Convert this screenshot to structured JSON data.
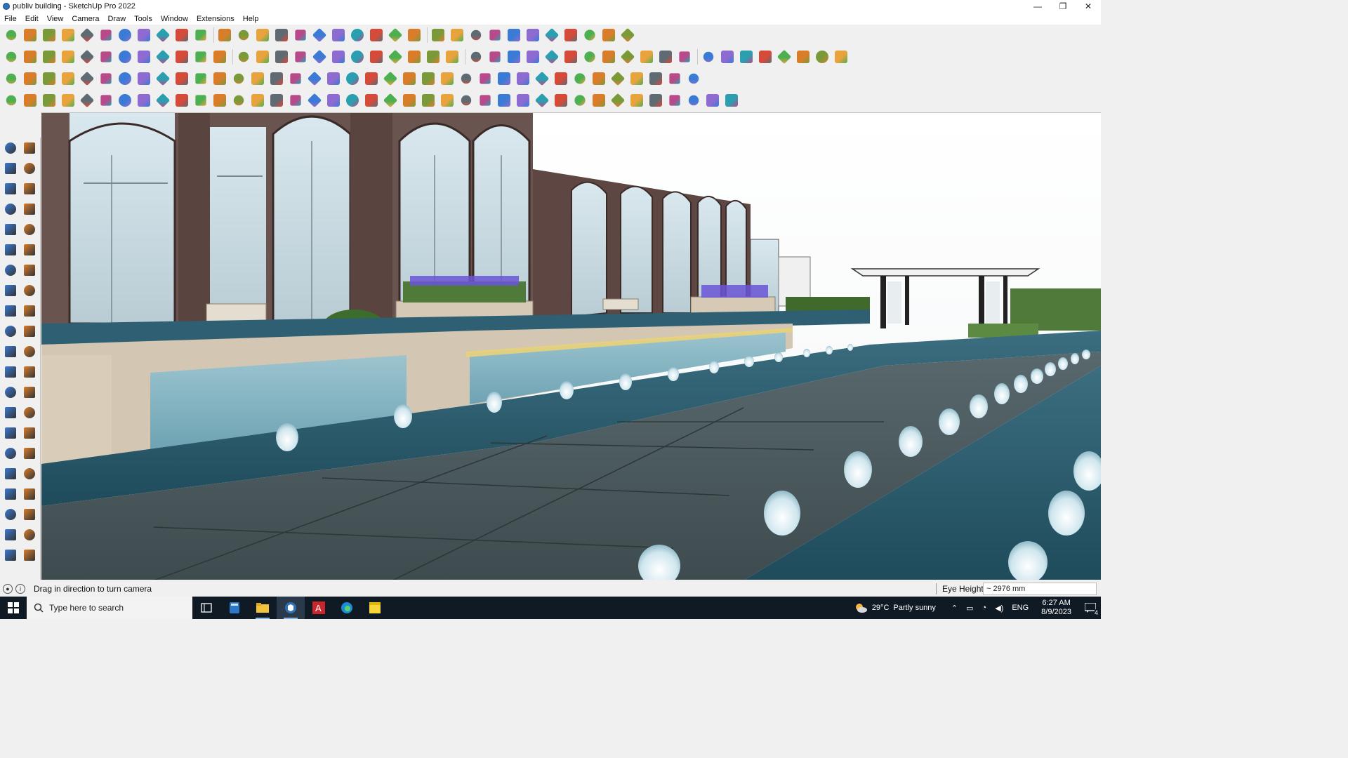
{
  "window": {
    "title": "publiv building - SketchUp Pro 2022",
    "controls": [
      "minimize-icon",
      "maximize-icon",
      "close-icon"
    ]
  },
  "menu": {
    "items": [
      "File",
      "Edit",
      "View",
      "Camera",
      "Draw",
      "Tools",
      "Window",
      "Extensions",
      "Help"
    ]
  },
  "toolbars": {
    "row1_icons": [
      "zoom-icon",
      "select-icon",
      "eraser-icon",
      "line-icon",
      "arc-icon",
      "rectangle-icon",
      "push-pull-icon",
      "follow-me-icon",
      "move-icon",
      "rotate-icon",
      "scale-icon",
      "tape-measure-icon",
      "text-icon",
      "paint-bucket-icon",
      "orbit-icon",
      "pan-icon",
      "zoom-window-icon",
      "zoom-extents-icon",
      "component-icon",
      "layers-icon",
      "layers-2-icon",
      "section-icon",
      "user-icon",
      "warehouse-icon",
      "extension-icon",
      "bar-icon",
      "updown-icon",
      "updown-2-icon",
      "match-photo-icon",
      "sandbox-icon",
      "undo-icon",
      "redo-icon",
      "trash-icon"
    ],
    "row2_icons": [
      "cube-icon",
      "cube-2-icon",
      "cube-3-icon",
      "axes-icon",
      "axes-x-icon",
      "axes-y-icon",
      "axes-r-icon",
      "axes-v-icon",
      "axes-n-icon",
      "axes-x2-icon",
      "axes-f-icon",
      "curve-icon",
      "blade-icon",
      "blade-2-icon",
      "blade-3-icon",
      "plane-icon",
      "plane-2-icon",
      "house-1-icon",
      "house-2-icon",
      "house-3-icon",
      "house-4-icon",
      "house-5-icon",
      "fx-icon",
      "leaf-icon",
      "knife-icon",
      "circle-1-icon",
      "circle-2-icon",
      "circle-3-icon",
      "circle-4-icon",
      "circle-5-icon",
      "circle-6-icon",
      "circle-7-icon",
      "circle-8-icon",
      "circle-9-icon",
      "circle-10-icon",
      "red-line-icon",
      "red-shape-icon",
      "cone-icon",
      "grid-icon",
      "sphere-icon",
      "sphere-2-icon",
      "hand-icon",
      "chip-icon",
      "chip-2-icon"
    ],
    "row3_icons": [
      "diamond-blue-icon",
      "diamond-blue-2-icon",
      "diamond-yellow-icon",
      "diamond-green-icon",
      "diamond-red-icon",
      "diamond-gray-icon",
      "spin-icon",
      "square-red-icon",
      "stack-icon",
      "page-icon",
      "box-icon",
      "chain-icon",
      "dots-icon",
      "cross-red-icon",
      "cross-green-icon",
      "cross-blue-icon",
      "cone-blue-icon",
      "fire-icon",
      "warn-icon",
      "spiral-icon",
      "spiral-2-icon",
      "spiral-3-icon",
      "nodes-icon",
      "bucket-icon",
      "magnet-icon",
      "grid-green-icon",
      "cubes-icon",
      "cubes-2-icon",
      "cubes-3-icon",
      "red-box-icon",
      "grid-2-icon",
      "stair-icon",
      "grid-yellow-icon",
      "grid-orange-icon",
      "x-red-icon",
      "arc-dot-icon",
      "square-dots-icon"
    ],
    "row4_icons": [
      "corner-icon",
      "wave-icon",
      "car-icon",
      "scissors-icon",
      "gear-icon",
      "cloud-icon",
      "hook-icon",
      "ring-icon",
      "globe-icon",
      "flow-icon",
      "wall-icon",
      "fence-icon",
      "slope-icon",
      "roof-icon",
      "box-house-icon",
      "beam-icon",
      "stairs-icon",
      "rails-icon",
      "rails-2-icon",
      "hand-2-icon",
      "sofa-icon",
      "chair-icon",
      "bench-icon",
      "table-icon",
      "lamp-icon",
      "slab-icon",
      "hatch-icon",
      "lines-icon",
      "pole-icon",
      "mesh-icon",
      "mesh-2-icon",
      "hex-icon",
      "stack-2-icon",
      "stripe-icon",
      "bars-icon",
      "rails-3-icon",
      "net-icon",
      "tri-icon",
      "hex-2-icon"
    ]
  },
  "left_tray_icons": [
    "select-icon",
    "orbit-2-icon",
    "paint-bucket-icon",
    "eraser-icon",
    "component-icon",
    "tape-icon",
    "pencil-icon",
    "freehand-icon",
    "rectangle-icon",
    "rect-rotated-icon",
    "circle-icon",
    "polygon-icon",
    "arc-icon",
    "arc-2-icon",
    "pie-icon",
    "arc-3-icon",
    "move-icon",
    "push-pull-icon",
    "rotate-icon",
    "follow-me-icon",
    "scale-icon",
    "offset-icon",
    "tape-measure-icon",
    "dimension-icon",
    "protractor-icon",
    "text-icon",
    "axes-icon",
    "3d-text-icon",
    "orbit-icon",
    "pan-icon",
    "zoom-icon",
    "zoom-window-icon",
    "zoom-extents-icon",
    "previous-icon",
    "walk-icon",
    "look-around-icon",
    "position-camera-icon",
    "section-plane-icon",
    "warehouse-icon",
    "extension-icon",
    "layers-icon",
    "layers-2-icon"
  ],
  "status": {
    "message": "Drag in direction to turn camera",
    "vcb_label": "Eye Height",
    "vcb_value": "~ 2976 mm"
  },
  "taskbar": {
    "search_placeholder": "Type here to search",
    "apps": [
      "task-view-icon",
      "calculator-icon",
      "file-explorer-icon",
      "sketchup-icon",
      "autocad-icon",
      "edge-icon",
      "sticky-notes-icon"
    ],
    "weather_temp": "29°C",
    "weather_desc": "Partly sunny",
    "language": "ENG",
    "time": "6:27 AM",
    "date": "8/9/2023",
    "notifications": "4"
  },
  "colors": {
    "sky": "#ffffff",
    "building_brown": "#5e4743",
    "glass": "#cfe0e8",
    "stone": "#d8ccb9",
    "paving": "#4a5a5f",
    "water": "#2d5f72",
    "hedge": "#4f7a3a",
    "lavender": "#6a55d6",
    "taskbar": "#101a24"
  }
}
